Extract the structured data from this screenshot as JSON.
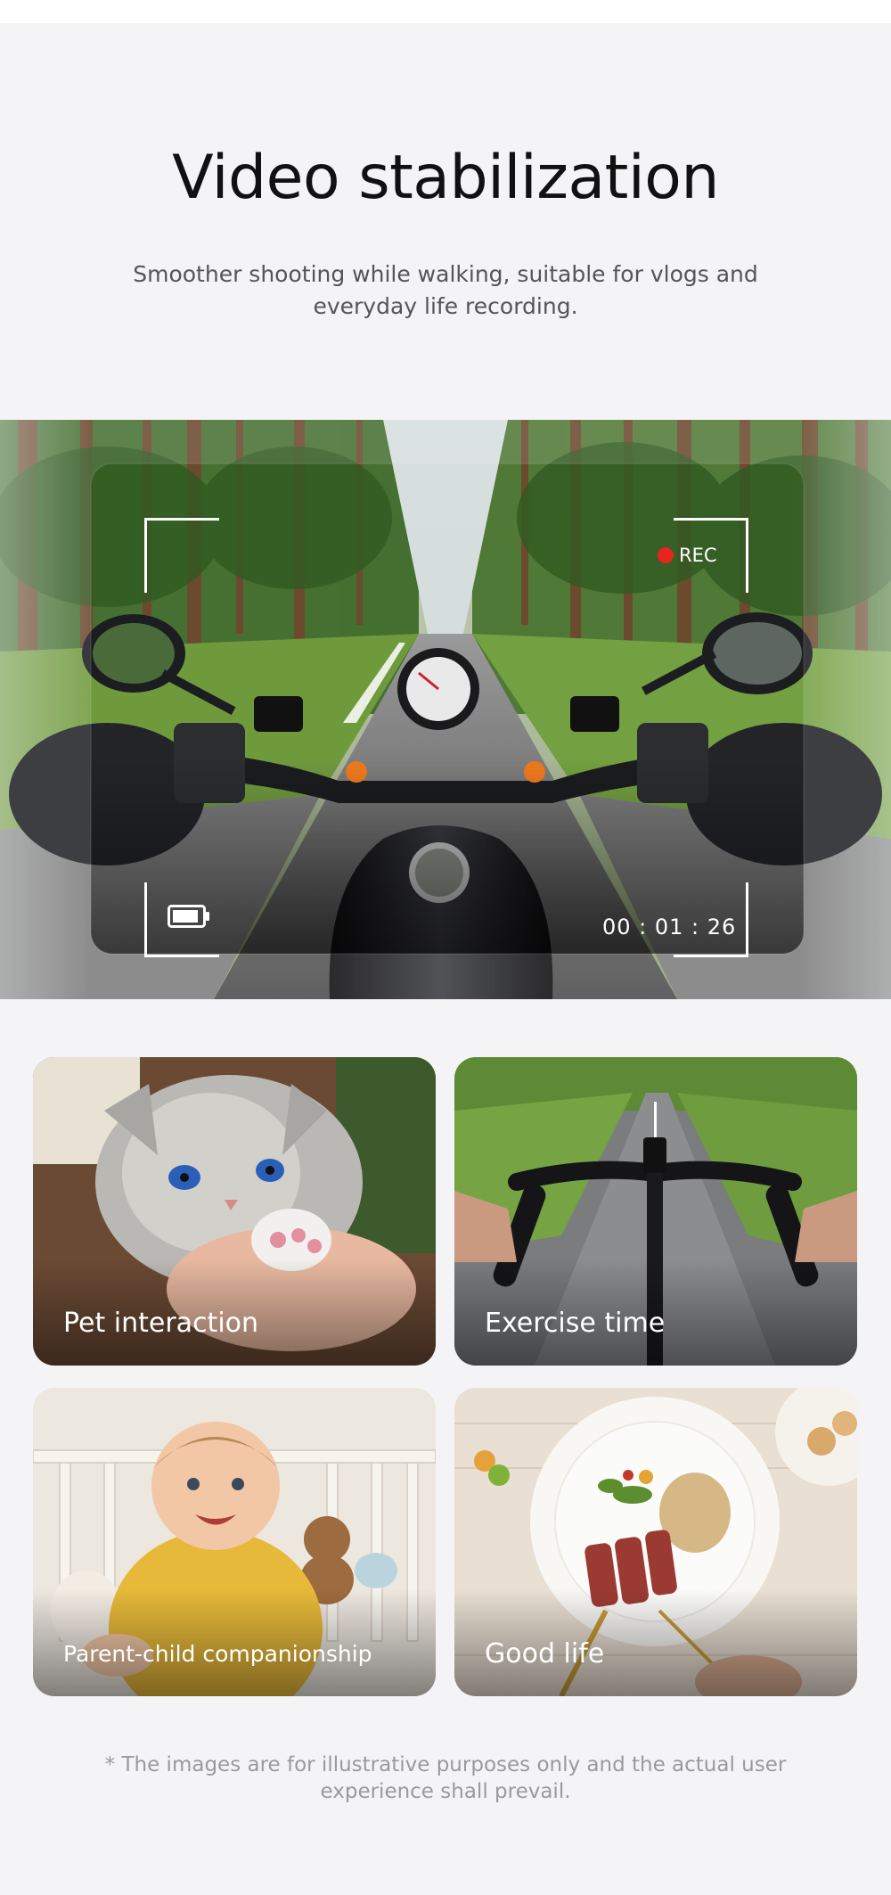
{
  "header": {
    "title": "Video stabilization",
    "subtitle": "Smoother shooting while walking, suitable for vlogs and everyday life recording."
  },
  "hero": {
    "rec_label": "REC",
    "timer": "00 : 01 : 26",
    "rec_color": "#e8241f"
  },
  "scenarios": [
    {
      "label": "Pet interaction"
    },
    {
      "label": "Exercise time"
    },
    {
      "label": "Parent-child companionship"
    },
    {
      "label": "Good life"
    }
  ],
  "footer": {
    "disclaimer": "* The images are for illustrative purposes only and the actual user experience shall prevail."
  }
}
